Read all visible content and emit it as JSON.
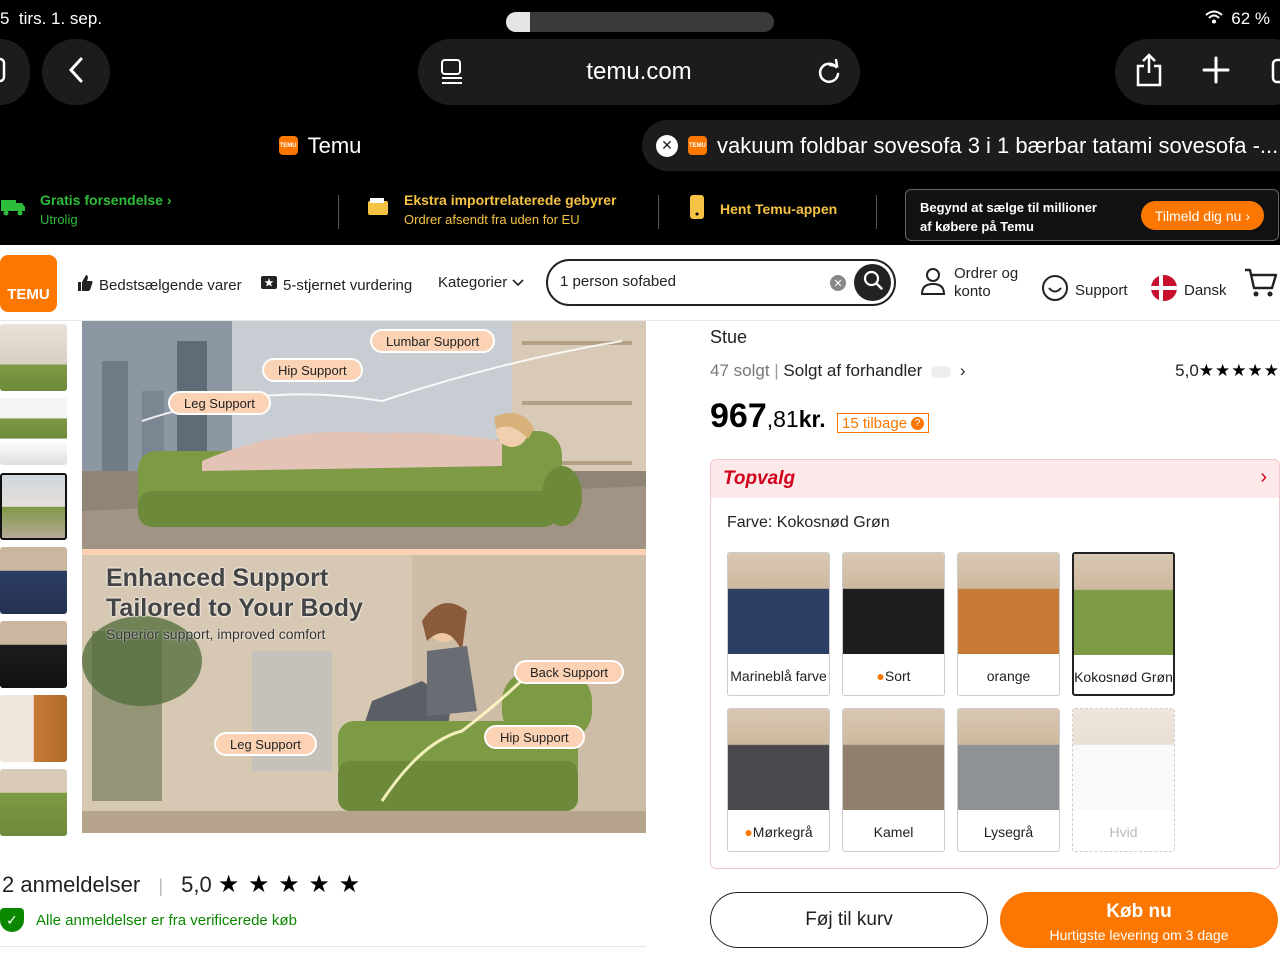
{
  "status": {
    "time_fragment": "5",
    "date": "tirs. 1. sep.",
    "battery": "62 %"
  },
  "browser": {
    "url": "temu.com"
  },
  "tabs": [
    {
      "title": "Temu"
    },
    {
      "title": "vakuum foldbar sovesofa 3 i 1 bærbar tatami sovesofa -..."
    }
  ],
  "promo": {
    "shipping_title": "Gratis forsendelse",
    "shipping_sub": "Utrolig",
    "import_title": "Ekstra importrelaterede gebyrer",
    "import_sub": "Ordrer afsendt fra uden for EU",
    "app_title": "Hent Temu-appen",
    "join_line1": "Begynd at sælge til millioner",
    "join_line2": "af købere på Temu",
    "join_button": "Tilmeld dig nu"
  },
  "nav": {
    "logo": "TEMU",
    "bestsellers": "Bedstsælgende varer",
    "five_star": "5-stjernet vurdering",
    "categories": "Kategorier",
    "search_value": "1 person sofabed",
    "orders_line1": "Ordrer og",
    "orders_line2": "konto",
    "support": "Support",
    "language": "Dansk"
  },
  "image": {
    "badges_top": [
      "Lumbar Support",
      "Hip Support",
      "Leg Support"
    ],
    "headline_1": "Enhanced Support",
    "headline_2": "Tailored to Your Body",
    "subline": "Superior support, improved comfort",
    "badges_bottom": [
      "Back Support",
      "Hip Support",
      "Leg Support"
    ]
  },
  "reviews": {
    "count": "2 anmeldelser",
    "score": "5,0",
    "stars": "★ ★ ★ ★ ★",
    "verified": "Alle anmeldelser er fra verificerede køb"
  },
  "product": {
    "breadcrumb": "Stue",
    "sold": "47 solgt",
    "seller": "Solgt af forhandler",
    "rating": "5,0",
    "rating_stars": "★★★★★",
    "price_int": "967",
    "price_dec": ",81",
    "price_unit": "kr.",
    "returns": "15 tilbage",
    "topvalg": "Topvalg",
    "color_label": "Farve: Kokosnød Grøn"
  },
  "swatches": [
    {
      "label": "Marineblå farve",
      "color": "#2d3e63",
      "hot": false,
      "selected": false,
      "disabled": false
    },
    {
      "label": "Sort",
      "color": "#1d1d1f",
      "hot": true,
      "selected": false,
      "disabled": false
    },
    {
      "label": "orange",
      "color": "#c77b36",
      "hot": false,
      "selected": false,
      "disabled": false
    },
    {
      "label": "Kokosnød Grøn",
      "color": "#7d9a45",
      "hot": false,
      "selected": true,
      "disabled": false
    },
    {
      "label": "Mørkegrå",
      "color": "#4a4a4e",
      "hot": true,
      "selected": false,
      "disabled": false
    },
    {
      "label": "Kamel",
      "color": "#8f7f6c",
      "hot": false,
      "selected": false,
      "disabled": false
    },
    {
      "label": "Lysegrå",
      "color": "#8e9196",
      "hot": false,
      "selected": false,
      "disabled": false
    },
    {
      "label": "Hvid",
      "color": "#f2f2f2",
      "hot": false,
      "selected": false,
      "disabled": true
    }
  ],
  "actions": {
    "add_to_cart": "Føj til kurv",
    "buy_now": "Køb nu",
    "buy_sub": "Hurtigste levering om 3 dage"
  },
  "colors": {
    "accent": "#fb7701",
    "topvalg": "#d0021b",
    "verified": "#0a8800"
  }
}
